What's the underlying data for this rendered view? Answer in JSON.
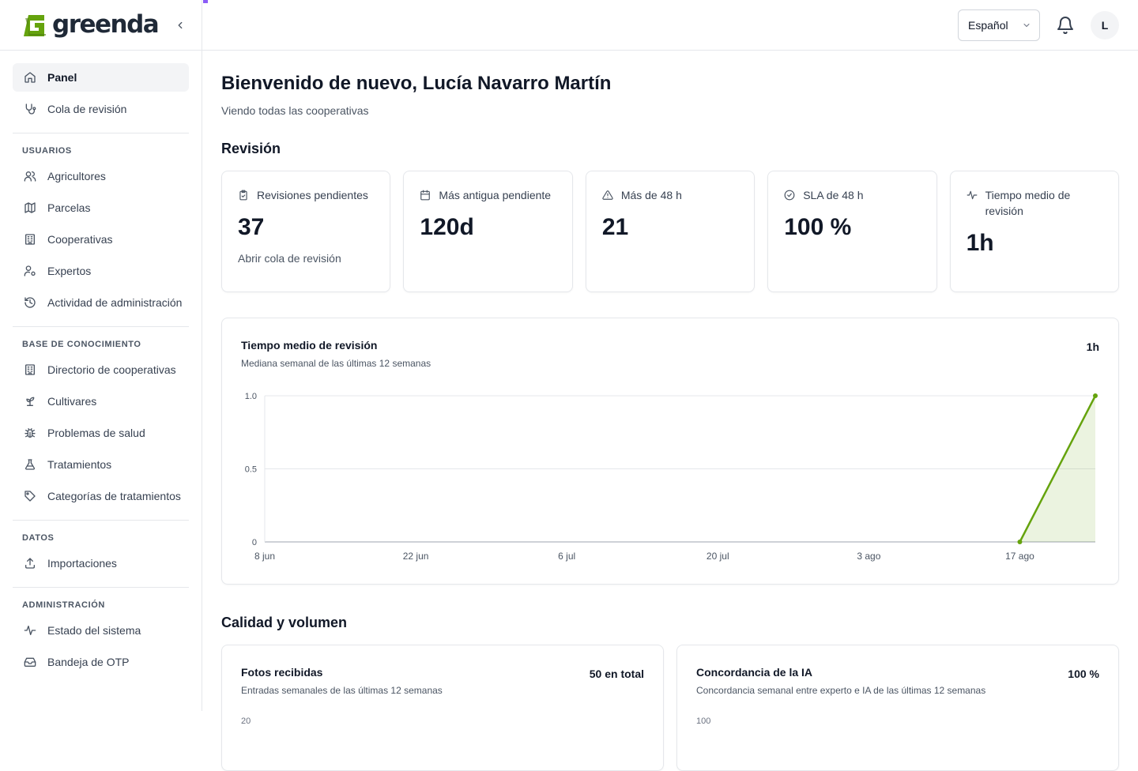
{
  "brand": {
    "name": "greenda",
    "accent": "#8b5cf6",
    "logo_green": "#65a30d"
  },
  "sidebar": {
    "main_items": [
      {
        "label": "Panel",
        "icon": "home-icon",
        "active": true
      },
      {
        "label": "Cola de revisión",
        "icon": "stethoscope-icon",
        "active": false
      }
    ],
    "sections": [
      {
        "title": "USUARIOS",
        "items": [
          {
            "label": "Agricultores",
            "icon": "users-icon"
          },
          {
            "label": "Parcelas",
            "icon": "map-icon"
          },
          {
            "label": "Cooperativas",
            "icon": "building-icon"
          },
          {
            "label": "Expertos",
            "icon": "user-cog-icon"
          },
          {
            "label": "Actividad de administración",
            "icon": "history-icon"
          }
        ]
      },
      {
        "title": "BASE DE CONOCIMIENTO",
        "items": [
          {
            "label": "Directorio de cooperativas",
            "icon": "building-icon"
          },
          {
            "label": "Cultivares",
            "icon": "sprout-icon"
          },
          {
            "label": "Problemas de salud",
            "icon": "bug-icon"
          },
          {
            "label": "Tratamientos",
            "icon": "flask-icon"
          },
          {
            "label": "Categorías de tratamientos",
            "icon": "tag-icon"
          }
        ]
      },
      {
        "title": "DATOS",
        "items": [
          {
            "label": "Importaciones",
            "icon": "upload-icon"
          }
        ]
      },
      {
        "title": "ADMINISTRACIÓN",
        "items": [
          {
            "label": "Estado del sistema",
            "icon": "activity-icon"
          },
          {
            "label": "Bandeja de OTP",
            "icon": "inbox-icon"
          }
        ]
      }
    ]
  },
  "topbar": {
    "language": "Español",
    "avatar_initial": "L"
  },
  "main": {
    "welcome": "Bienvenido de nuevo, Lucía Navarro Martín",
    "subtitle": "Viendo todas las cooperativas",
    "review_title": "Revisión",
    "kpis": [
      {
        "label": "Revisiones pendientes",
        "value": "37",
        "link": "Abrir cola de revisión",
        "icon": "clipboard-icon"
      },
      {
        "label": "Más antigua pendiente",
        "value": "120d",
        "link": "",
        "icon": "calendar-icon"
      },
      {
        "label": "Más de 48 h",
        "value": "21",
        "link": "",
        "icon": "alert-triangle-icon"
      },
      {
        "label": "SLA de 48 h",
        "value": "100 %",
        "link": "",
        "icon": "check-circle-icon"
      },
      {
        "label": "Tiempo medio de revisión",
        "value": "1h",
        "link": "",
        "icon": "activity-icon"
      }
    ],
    "quality_title": "Calidad y volumen",
    "photos_card": {
      "title": "Fotos recibidas",
      "subtitle": "Entradas semanales de las últimas 12 semanas",
      "total": "50 en total",
      "first_tick": "20"
    },
    "ai_card": {
      "title": "Concordancia de la IA",
      "subtitle": "Concordancia semanal entre experto e IA de las últimas 12 semanas",
      "total": "100 %",
      "first_tick": "100"
    }
  },
  "review_time_card": {
    "title": "Tiempo medio de revisión",
    "subtitle": "Mediana semanal de las últimas 12 semanas",
    "headline": "1h"
  },
  "chart_data": {
    "type": "area",
    "title": "Tiempo medio de revisión",
    "subtitle": "Mediana semanal de las últimas 12 semanas",
    "x_tick_labels": [
      "8 jun",
      "22 jun",
      "6 jul",
      "20 jul",
      "3 ago",
      "17 ago"
    ],
    "y_tick_labels": [
      "0",
      "0.5",
      "1.0"
    ],
    "ylim": [
      0,
      1
    ],
    "grid": true,
    "color": "#65a30d",
    "series": [
      {
        "x": [
          "17 ago",
          "24 ago"
        ],
        "values": [
          0,
          1
        ]
      }
    ]
  }
}
